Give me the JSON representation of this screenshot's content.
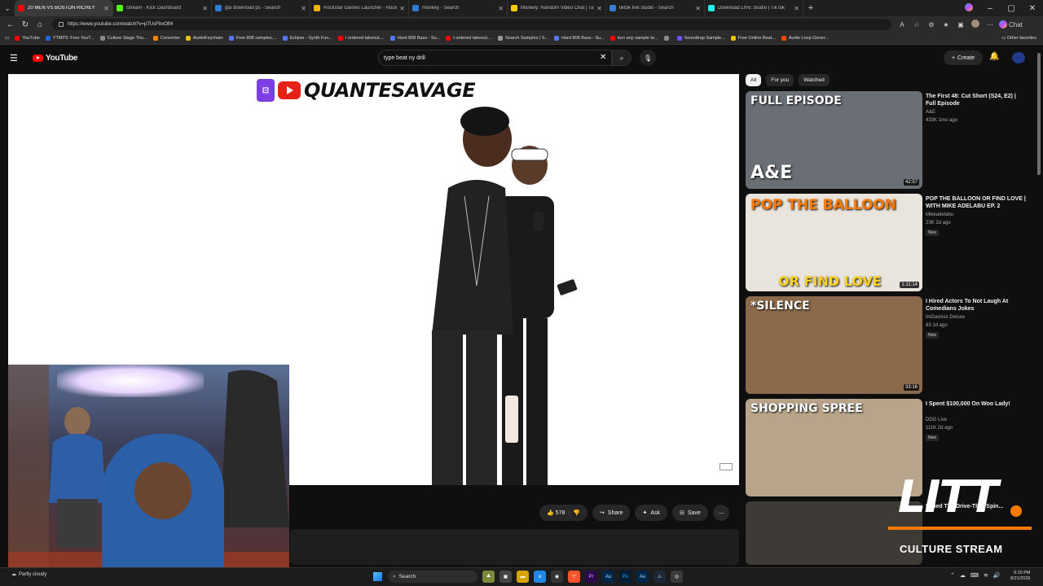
{
  "browser": {
    "tabs": [
      {
        "title": "20 MEN VS BOSTON RICHEY",
        "color": "#ff0000",
        "active": true
      },
      {
        "title": "Stream - Kick Dashboard",
        "color": "#53fc18"
      },
      {
        "title": "gta download pc - Search",
        "color": "#2f7cd3"
      },
      {
        "title": "Rockstar Games Launcher - Rockst",
        "color": "#f6b300"
      },
      {
        "title": "monkey - Search",
        "color": "#2f7cd3"
      },
      {
        "title": "Monkey: Random Video Chat | Ta",
        "color": "#ffcc00"
      },
      {
        "title": "tiktok live studio - Search",
        "color": "#2f7cd3"
      },
      {
        "title": "Download LIVE Studio | TikTok",
        "color": "#25f4ee"
      }
    ],
    "new_tab_icon": "plus-icon",
    "url": "https://www.youtube.com/watch?v=pTUsFbvOfl4",
    "chat_label": "Chat",
    "bookmarks": [
      {
        "label": "YouTube",
        "color": "#ff0000"
      },
      {
        "label": "YTMP3: Free YouT...",
        "color": "#2266dd"
      },
      {
        "label": "Culture Stage Thu...",
        "color": "#888888"
      },
      {
        "label": "Converter",
        "color": "#ff8800"
      },
      {
        "label": "AudioKeychain",
        "color": "#e6c200"
      },
      {
        "label": "Free 808 samples,...",
        "color": "#5577ff"
      },
      {
        "label": "Eclipse - Synth Fun...",
        "color": "#5577ff"
      },
      {
        "label": "I ordered takeout....",
        "color": "#ff0000"
      },
      {
        "label": "Hard 808 Bass - Su...",
        "color": "#5577ff"
      },
      {
        "label": "I ordered takeout....",
        "color": "#ff0000"
      },
      {
        "label": "Search Samples | S...",
        "color": "#999999"
      },
      {
        "label": "Hard 808 Bass - Su...",
        "color": "#5577ff"
      },
      {
        "label": "turn any sample to...",
        "color": "#ff0000"
      },
      {
        "label": "",
        "color": "#888888"
      },
      {
        "label": "Soundtrap Sample...",
        "color": "#6655ff"
      },
      {
        "label": "Free Online Beat...",
        "color": "#e6c200"
      },
      {
        "label": "Audio Loop Gener...",
        "color": "#ff4400"
      }
    ],
    "other_favorites": "Other favorites"
  },
  "youtube": {
    "brand": "YouTube",
    "search_query": "type beat ny drill",
    "create_label": "Create",
    "video": {
      "watermark": "QUANTESAVAGE",
      "likes": "578",
      "share_label": "Share",
      "ask_label": "Ask",
      "save_label": "Save"
    },
    "chips": [
      "All",
      "For you",
      "Watched"
    ],
    "recommendations": [
      {
        "title": "The First 48: Cut Short (S24, E2) | Full Episode",
        "channel": "A&E",
        "stats": "433K  1mo ago",
        "duration": "42:57",
        "new": "",
        "thumb_text": "FULL EPISODE",
        "thumb_sub": "A&E",
        "bg": "#6a6f75"
      },
      {
        "title": "POP THE BALLOON OR FIND LOVE | WITH MIKE ADELABU EP. 2",
        "channel": "Mikeadelabu",
        "stats": "23K  2d ago",
        "duration": "1:11:14",
        "new": "New",
        "thumb_text": "POP THE BALLOON",
        "thumb_sub": "OR FIND LOVE",
        "bg": "#e9e4dc"
      },
      {
        "title": "I Hired Actors To Not Laugh At Comedians Jokes",
        "channel": "ImDavisss Deluxe",
        "stats": "83  1d ago",
        "duration": "33:16",
        "new": "New",
        "thumb_text": "*SILENCE",
        "thumb_sub": "",
        "bg": "#8a6a4a"
      },
      {
        "title": "I Spent $100,000 On Woo Lady!",
        "channel": "DDG Live",
        "stats": "111K  2d ago",
        "duration": "",
        "new": "New",
        "thumb_text": "SHOPPING SPREE",
        "thumb_sub": "",
        "bg": "#b7a48a"
      },
      {
        "title": "I Tried The Drive-Thru Spin...",
        "channel": "",
        "stats": "",
        "duration": "",
        "new": "",
        "thumb_text": "",
        "thumb_sub": "",
        "bg": "#3e3a36"
      }
    ]
  },
  "overlay": {
    "logo_text": "LITT",
    "subtitle": "CULTURE STREAM"
  },
  "taskbar": {
    "weather": "Partly cloudy",
    "search_label": "Search",
    "time": "9:10 PM",
    "date": "8/21/2026"
  }
}
